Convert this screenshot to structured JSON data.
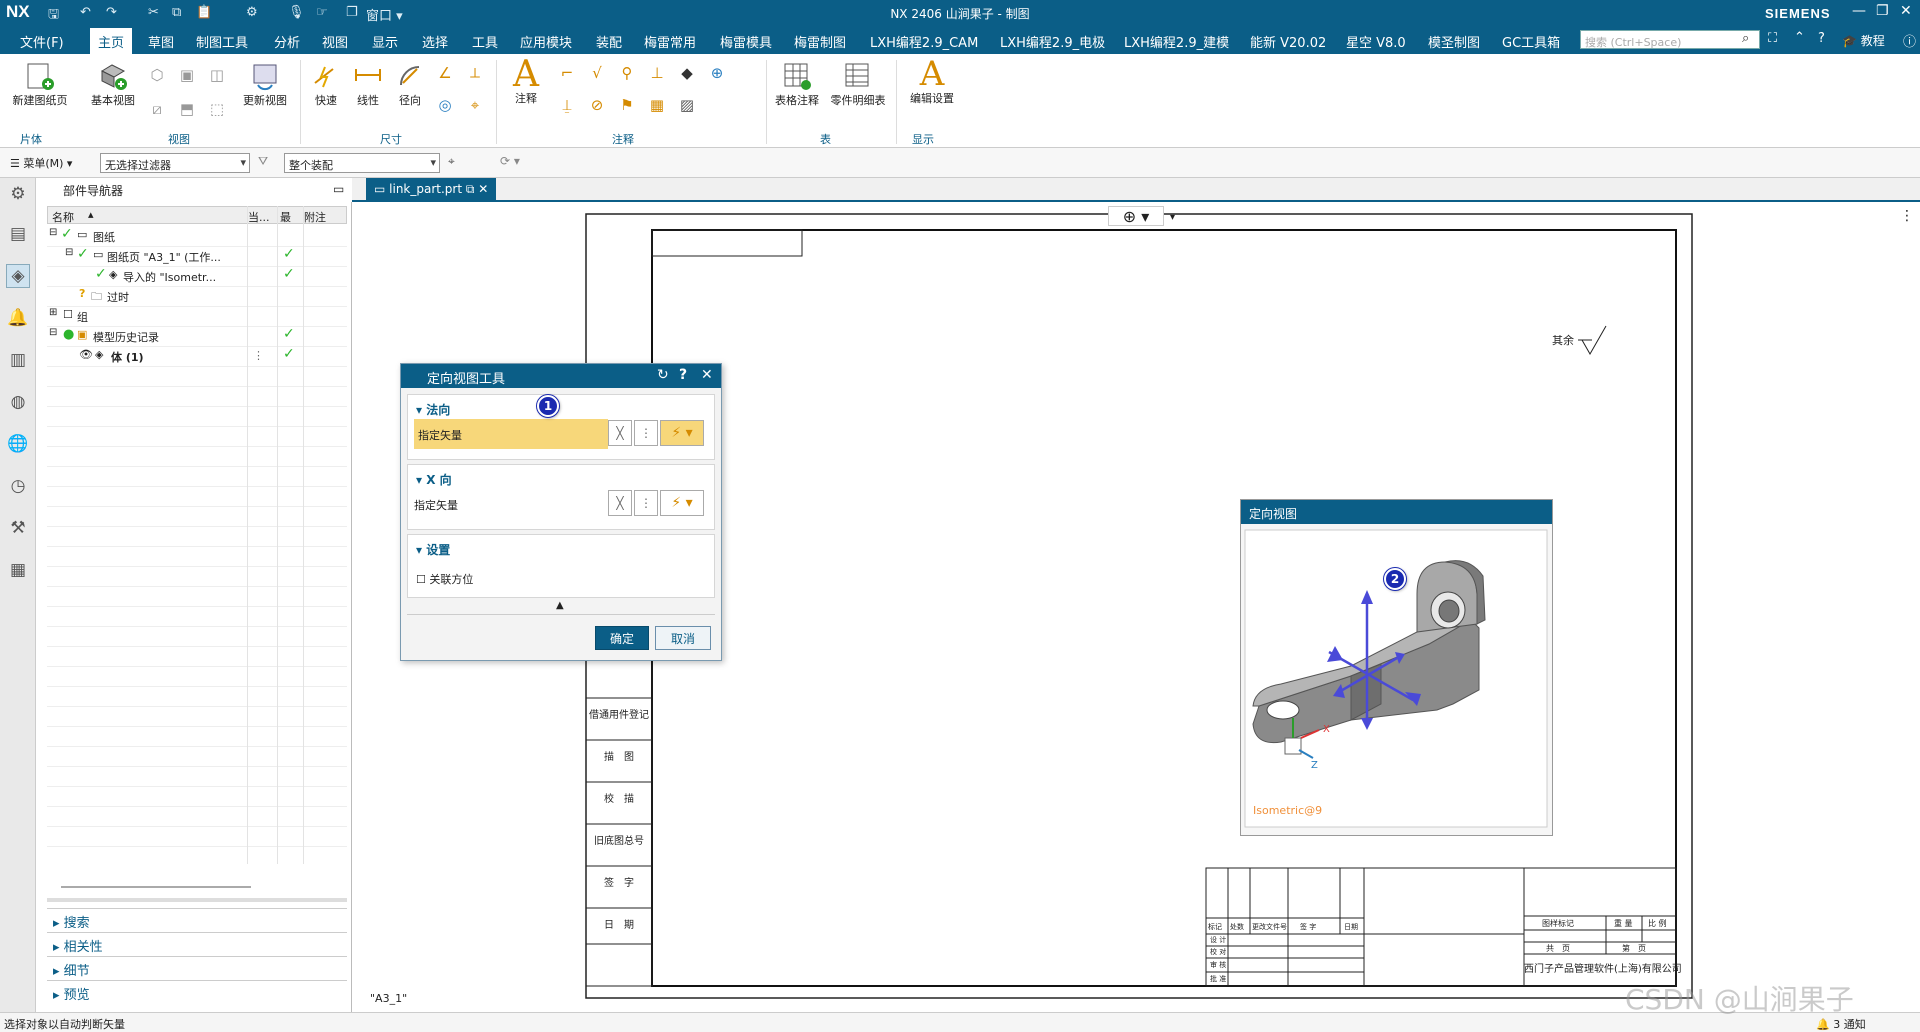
{
  "titlebar": {
    "logo": "NX",
    "window_menu": "窗口",
    "title": "NX 2406 山涧果子 - 制图",
    "brand": "SIEMENS"
  },
  "menubar": {
    "items": [
      "文件(F)",
      "主页",
      "草图",
      "制图工具",
      "分析",
      "视图",
      "显示",
      "选择",
      "工具",
      "应用模块",
      "装配",
      "梅雷常用",
      "梅雷模具",
      "梅雷制图",
      "LXH编程2.9_CAM",
      "LXH编程2.9_电极",
      "LXH编程2.9_建模",
      "能新 V20.02",
      "星空 V8.0",
      "模圣制图",
      "GC工具箱"
    ],
    "search_placeholder": "搜索 (Ctrl+Space)",
    "help_label": "教程"
  },
  "ribbon": {
    "new_sheet": "新建图纸页",
    "base_view": "基本视图",
    "update_view": "更新视图",
    "quick": "快速",
    "linear": "线性",
    "radial": "径向",
    "note": "注释",
    "table_note": "表格注释",
    "parts_list": "零件明细表",
    "edit_settings": "编辑设置",
    "groups": {
      "sheet": "片体",
      "view": "视图",
      "dimension": "尺寸",
      "annotation": "注释",
      "table": "表",
      "display": "显示"
    }
  },
  "filterbar": {
    "menu_label": "菜单(M)",
    "filter": "无选择过滤器",
    "scope": "整个装配"
  },
  "navigator": {
    "title": "部件导航器",
    "columns": [
      "名称",
      "当...",
      "最",
      "附注"
    ],
    "rows": [
      {
        "label": "图纸",
        "checked": true
      },
      {
        "label": "图纸页 \"A3_1\" (工作...",
        "checked": true
      },
      {
        "label": "导入的 \"Isometr...",
        "checked": true
      },
      {
        "label": "过时",
        "checked": false
      },
      {
        "label": "组",
        "checked": false
      },
      {
        "label": "模型历史记录",
        "checked": true
      },
      {
        "label": "体 (1)",
        "checked": true
      }
    ],
    "accordion": [
      "搜索",
      "相关性",
      "细节",
      "预览"
    ]
  },
  "doc_tab": {
    "name": "link_part.prt"
  },
  "drawing": {
    "sheet_label": "\"A3_1\"",
    "rough_note": "其余",
    "side_labels": [
      "借通用件登记",
      "描　图",
      "校　描",
      "旧底图总号",
      "签　字",
      "日　期"
    ],
    "tb_revision_headers": [
      "标记",
      "处数",
      "更改文件号",
      "签 字",
      "日期"
    ],
    "tb_roles": [
      "设 计",
      "校 对",
      "审 核",
      "批 准"
    ],
    "tb_right_headers": [
      "图样标记",
      "重 量",
      "比 例"
    ],
    "tb_sheets": [
      "共　页",
      "第　页"
    ],
    "company": "西门子产品管理软件(上海)有限公司"
  },
  "dialog": {
    "title": "定向视图工具",
    "section_normal": "法向",
    "specify_vector": "指定矢量",
    "section_x": "X 向",
    "specify_vector_x": "指定矢量",
    "section_settings": "设置",
    "associative": "关联方位",
    "ok": "确定",
    "cancel": "取消"
  },
  "orient_view": {
    "title": "定向视图",
    "view_label": "Isometric@9",
    "axis_x": "X",
    "axis_z": "Z"
  },
  "badges": {
    "one": "1",
    "two": "2"
  },
  "statusbar": {
    "message": "选择对象以自动判断矢量",
    "notifications": "3 通知"
  },
  "watermark": "CSDN @山涧果子",
  "colors": {
    "accent": "#0b5e87",
    "highlight": "#f7d77a",
    "badge": "#1a2ab0"
  }
}
